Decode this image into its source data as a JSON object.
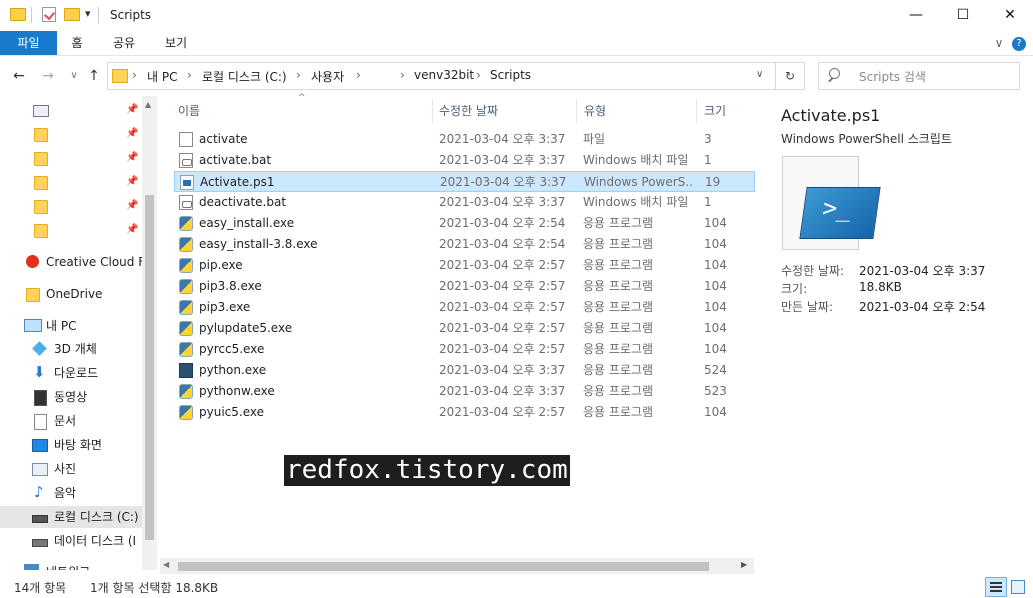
{
  "window": {
    "title": "Scripts",
    "minimize": "—",
    "maximize": "☐",
    "close": "✕",
    "qa_dropdown": "▾"
  },
  "ribbon": {
    "tabs": [
      "파일",
      "홈",
      "공유",
      "보기"
    ],
    "expand": "∨",
    "help": "?"
  },
  "address": {
    "back": "←",
    "forward": "→",
    "recent": "∨",
    "up": "↑",
    "crumbs": [
      "내 PC",
      "로컬 디스크 (C:)",
      "사용자",
      "",
      "venv32bit",
      "Scripts"
    ],
    "sep": "›",
    "dropdown": "∨",
    "refresh": "↻"
  },
  "search": {
    "placeholder": "Scripts 검색",
    "icon": "search-icon"
  },
  "sidebar": {
    "quick_access": [
      {
        "pinned": true
      },
      {
        "pinned": true
      },
      {
        "pinned": true
      },
      {
        "pinned": true
      },
      {
        "pinned": true
      },
      {
        "pinned": true
      }
    ],
    "items": [
      {
        "label": "Creative Cloud Fil",
        "icon": "creative-cloud-icon"
      },
      {
        "label": "OneDrive",
        "icon": "folder-icon"
      },
      {
        "label": "내 PC",
        "icon": "computer-icon"
      },
      {
        "label": "3D 개체",
        "icon": "cube-icon"
      },
      {
        "label": "다운로드",
        "icon": "download-icon"
      },
      {
        "label": "동영상",
        "icon": "video-icon"
      },
      {
        "label": "문서",
        "icon": "document-icon"
      },
      {
        "label": "바탕 화면",
        "icon": "desktop-icon"
      },
      {
        "label": "사진",
        "icon": "picture-icon"
      },
      {
        "label": "음악",
        "icon": "music-icon"
      },
      {
        "label": "로컬 디스크 (C:)",
        "icon": "drive-icon",
        "selected": true
      },
      {
        "label": "데이터 디스크 (I",
        "icon": "drive-icon"
      },
      {
        "label": "네트워크",
        "icon": "network-icon"
      }
    ]
  },
  "columns": {
    "name": "이름",
    "date": "수정한 날짜",
    "type": "유형",
    "size": "크기",
    "sort": "^"
  },
  "files": [
    {
      "name": "activate",
      "date": "2021-03-04 오후 3:37",
      "type": "파일",
      "size": "3",
      "icon": "file"
    },
    {
      "name": "activate.bat",
      "date": "2021-03-04 오후 3:37",
      "type": "Windows 배치 파일",
      "size": "1",
      "icon": "bat"
    },
    {
      "name": "Activate.ps1",
      "date": "2021-03-04 오후 3:37",
      "type": "Windows PowerS...",
      "size": "19",
      "icon": "ps1",
      "selected": true
    },
    {
      "name": "deactivate.bat",
      "date": "2021-03-04 오후 3:37",
      "type": "Windows 배치 파일",
      "size": "1",
      "icon": "bat"
    },
    {
      "name": "easy_install.exe",
      "date": "2021-03-04 오후 2:54",
      "type": "응용 프로그램",
      "size": "104",
      "icon": "py"
    },
    {
      "name": "easy_install-3.8.exe",
      "date": "2021-03-04 오후 2:54",
      "type": "응용 프로그램",
      "size": "104",
      "icon": "py"
    },
    {
      "name": "pip.exe",
      "date": "2021-03-04 오후 2:57",
      "type": "응용 프로그램",
      "size": "104",
      "icon": "py"
    },
    {
      "name": "pip3.8.exe",
      "date": "2021-03-04 오후 2:57",
      "type": "응용 프로그램",
      "size": "104",
      "icon": "py"
    },
    {
      "name": "pip3.exe",
      "date": "2021-03-04 오후 2:57",
      "type": "응용 프로그램",
      "size": "104",
      "icon": "py"
    },
    {
      "name": "pylupdate5.exe",
      "date": "2021-03-04 오후 2:57",
      "type": "응용 프로그램",
      "size": "104",
      "icon": "py"
    },
    {
      "name": "pyrcc5.exe",
      "date": "2021-03-04 오후 2:57",
      "type": "응용 프로그램",
      "size": "104",
      "icon": "py"
    },
    {
      "name": "python.exe",
      "date": "2021-03-04 오후 3:37",
      "type": "응용 프로그램",
      "size": "524",
      "icon": "pyexe"
    },
    {
      "name": "pythonw.exe",
      "date": "2021-03-04 오후 3:37",
      "type": "응용 프로그램",
      "size": "523",
      "icon": "pyw"
    },
    {
      "name": "pyuic5.exe",
      "date": "2021-03-04 오후 2:57",
      "type": "응용 프로그램",
      "size": "104",
      "icon": "py"
    }
  ],
  "preview": {
    "title": "Activate.ps1",
    "subtitle": "Windows PowerShell 스크립트",
    "icon": "powershell-icon",
    "meta": [
      {
        "key": "수정한 날짜:",
        "value": "2021-03-04 오후 3:37"
      },
      {
        "key": "크기:",
        "value": "18.8KB"
      },
      {
        "key": "만든 날짜:",
        "value": "2021-03-04 오후 2:54"
      }
    ]
  },
  "status": {
    "count": "14개 항목",
    "selection": "1개 항목 선택함 18.8KB"
  },
  "watermark": "redfox.tistory.com",
  "colors": {
    "accent": "#1979ca",
    "selection_bg": "#cce8ff",
    "selection_border": "#99d1ff",
    "folder": "#ffd35a",
    "header_text": "#4c607a",
    "secondary_text": "#6d6d6d"
  }
}
